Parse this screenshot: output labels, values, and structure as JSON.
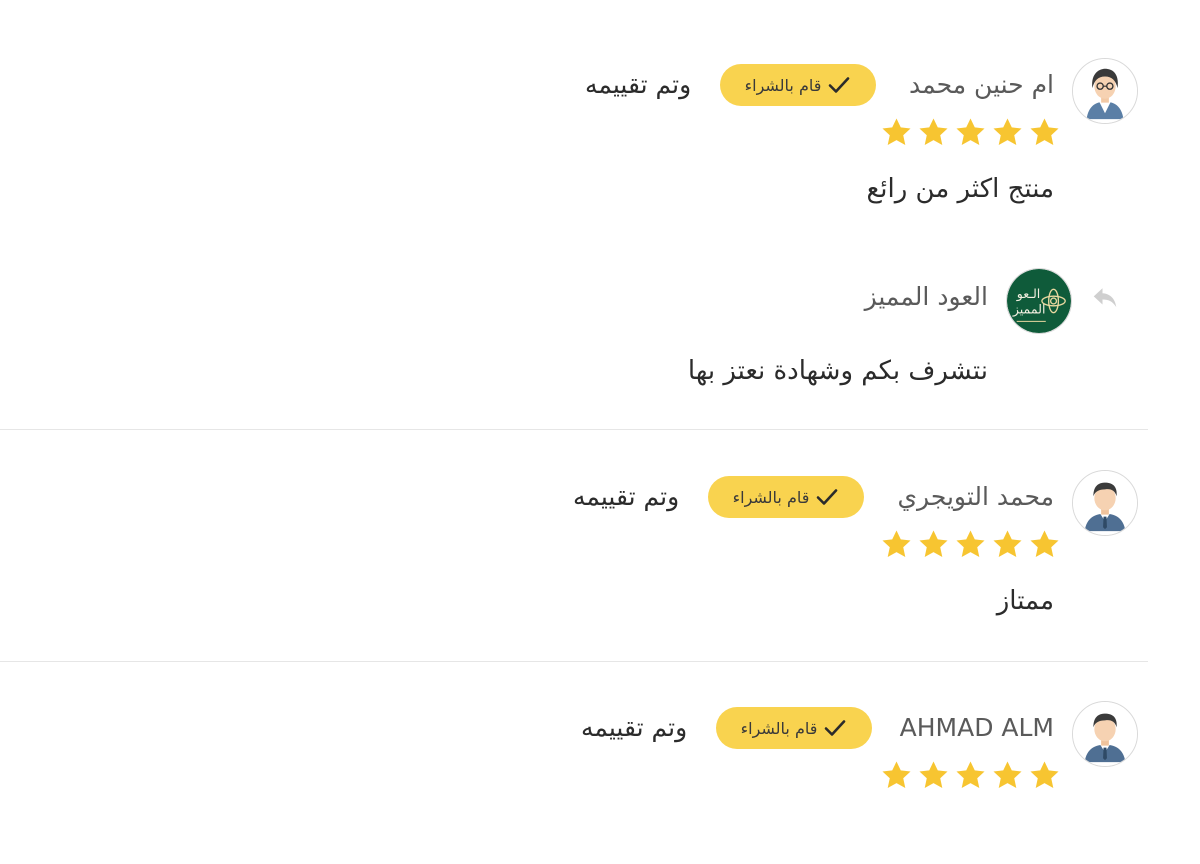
{
  "reviews": [
    {
      "name": "ام حنين محمد",
      "avatar_icon": "woman-avatar-icon",
      "badge_label": "قام بالشراء",
      "rated_text": "وتم تقييمه",
      "rating": 5,
      "comment": "منتج اكثر من رائع",
      "reply": {
        "name": "العود المميز",
        "avatar_icon": "store-logo-icon",
        "comment": "نتشرف بكم وشهادة نعتز بها"
      }
    },
    {
      "name": "محمد التويجري",
      "avatar_icon": "man-avatar-icon",
      "badge_label": "قام بالشراء",
      "rated_text": "وتم تقييمه",
      "rating": 5,
      "comment": "ممتاز"
    },
    {
      "name": "AHMAD ALM",
      "avatar_icon": "man-avatar-icon",
      "badge_label": "قام بالشراء",
      "rated_text": "وتم تقييمه",
      "rating": 5
    }
  ],
  "colors": {
    "star": "#f7c531",
    "badge": "#f9d34f",
    "divider": "#e6e6e6",
    "store_logo": "#0f5b3a"
  }
}
